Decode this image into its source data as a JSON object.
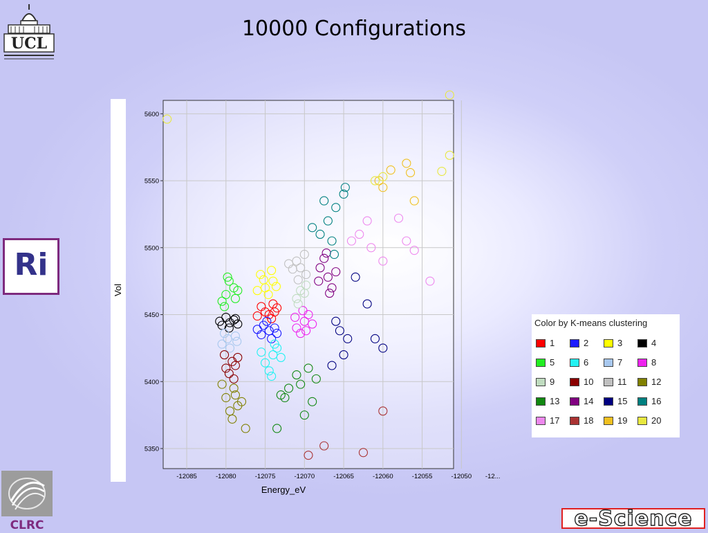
{
  "slide": {
    "title": "10000 Configurations"
  },
  "logos": {
    "ucl": "UCL",
    "ri": "Ri",
    "clrc": "CLRC",
    "escience": "e-Science"
  },
  "chart_data": {
    "type": "scatter",
    "title": "",
    "xlabel": "Energy_eV",
    "ylabel": "Vol",
    "xlim": [
      -12088,
      -12051
    ],
    "ylim": [
      5335,
      5610
    ],
    "x_ticks": [
      -12085,
      -12080,
      -12075,
      -12070,
      -12065,
      -12060,
      -12055,
      -12050
    ],
    "x_tick_labels": [
      "-12085",
      "-12080",
      "-12075",
      "-12070",
      "-12065",
      "-12060",
      "-12055",
      "-12050",
      "-12..."
    ],
    "y_ticks": [
      5350,
      5400,
      5450,
      5500,
      5550,
      5600
    ],
    "y_tick_labels": [
      "5350",
      "5400",
      "5450",
      "5500",
      "5550",
      "5600"
    ],
    "grid": true,
    "marker": "open-circle",
    "legend": {
      "title": "Color by K-means clustering",
      "placement": "right",
      "entries": [
        {
          "label": "1",
          "color": "#ff0000"
        },
        {
          "label": "2",
          "color": "#1a1aff"
        },
        {
          "label": "3",
          "color": "#ffff00"
        },
        {
          "label": "4",
          "color": "#000000"
        },
        {
          "label": "5",
          "color": "#22ee22"
        },
        {
          "label": "6",
          "color": "#22f2f2"
        },
        {
          "label": "7",
          "color": "#a8c8ee"
        },
        {
          "label": "8",
          "color": "#ee22ee"
        },
        {
          "label": "9",
          "color": "#c0dcc0"
        },
        {
          "label": "10",
          "color": "#8b0000"
        },
        {
          "label": "11",
          "color": "#c0c0c0"
        },
        {
          "label": "12",
          "color": "#808000"
        },
        {
          "label": "13",
          "color": "#118811"
        },
        {
          "label": "14",
          "color": "#800080"
        },
        {
          "label": "15",
          "color": "#000080"
        },
        {
          "label": "16",
          "color": "#008080"
        },
        {
          "label": "17",
          "color": "#ee88ee"
        },
        {
          "label": "18",
          "color": "#aa3333"
        },
        {
          "label": "19",
          "color": "#f0c020"
        },
        {
          "label": "20",
          "color": "#e8e840"
        }
      ]
    },
    "series": [
      {
        "cluster": "1",
        "color": "#ff0000",
        "points": [
          [
            -12074.5,
            5450
          ],
          [
            -12075.5,
            5456
          ],
          [
            -12073.8,
            5452
          ],
          [
            -12074.2,
            5447
          ],
          [
            -12075,
            5452
          ],
          [
            -12073.5,
            5455
          ],
          [
            -12076,
            5449
          ],
          [
            -12074,
            5458
          ]
        ]
      },
      {
        "cluster": "2",
        "color": "#1a1aff",
        "points": [
          [
            -12074.5,
            5438
          ],
          [
            -12075.5,
            5435
          ],
          [
            -12073.8,
            5440
          ],
          [
            -12074.2,
            5432
          ],
          [
            -12075.2,
            5442
          ],
          [
            -12073.5,
            5436
          ],
          [
            -12076,
            5439
          ],
          [
            -12074.8,
            5445
          ]
        ]
      },
      {
        "cluster": "3",
        "color": "#ffff00",
        "points": [
          [
            -12075,
            5470
          ],
          [
            -12074,
            5475
          ],
          [
            -12075.6,
            5480
          ],
          [
            -12074.6,
            5465
          ],
          [
            -12073.6,
            5471
          ],
          [
            -12075.2,
            5476
          ],
          [
            -12074.2,
            5483
          ],
          [
            -12076,
            5468
          ]
        ]
      },
      {
        "cluster": "4",
        "color": "#000000",
        "points": [
          [
            -12079.5,
            5444
          ],
          [
            -12080.5,
            5442
          ],
          [
            -12079,
            5446
          ],
          [
            -12080,
            5448
          ],
          [
            -12078.5,
            5443
          ],
          [
            -12080.8,
            5445
          ],
          [
            -12079.6,
            5440
          ],
          [
            -12078.8,
            5447
          ]
        ]
      },
      {
        "cluster": "5",
        "color": "#22ee22",
        "points": [
          [
            -12080,
            5465
          ],
          [
            -12079,
            5470
          ],
          [
            -12080.5,
            5460
          ],
          [
            -12078.8,
            5462
          ],
          [
            -12079.6,
            5475
          ],
          [
            -12080.2,
            5456
          ],
          [
            -12078.5,
            5468
          ],
          [
            -12079.8,
            5478
          ]
        ]
      },
      {
        "cluster": "6",
        "color": "#22f2f2",
        "points": [
          [
            -12074,
            5420
          ],
          [
            -12075,
            5414
          ],
          [
            -12073.5,
            5425
          ],
          [
            -12074.5,
            5408
          ],
          [
            -12073,
            5418
          ],
          [
            -12075.5,
            5422
          ],
          [
            -12074.2,
            5404
          ],
          [
            -12073.8,
            5428
          ]
        ]
      },
      {
        "cluster": "7",
        "color": "#a8c8ee",
        "points": [
          [
            -12079.8,
            5432
          ],
          [
            -12080.5,
            5428
          ],
          [
            -12078.8,
            5434
          ],
          [
            -12079.5,
            5425
          ],
          [
            -12080.2,
            5436
          ],
          [
            -12078.6,
            5430
          ]
        ]
      },
      {
        "cluster": "8",
        "color": "#ee22ee",
        "points": [
          [
            -12070,
            5445
          ],
          [
            -12071,
            5440
          ],
          [
            -12069.5,
            5450
          ],
          [
            -12070.5,
            5436
          ],
          [
            -12069,
            5443
          ],
          [
            -12071.2,
            5448
          ],
          [
            -12070.2,
            5453
          ],
          [
            -12069.8,
            5438
          ]
        ]
      },
      {
        "cluster": "9",
        "color": "#c0dcc0",
        "points": [
          [
            -12070.5,
            5468
          ],
          [
            -12071,
            5462
          ],
          [
            -12069.8,
            5472
          ],
          [
            -12070.8,
            5458
          ],
          [
            -12070,
            5466
          ]
        ]
      },
      {
        "cluster": "10",
        "color": "#8b0000",
        "points": [
          [
            -12079.2,
            5415
          ],
          [
            -12080,
            5410
          ],
          [
            -12078.5,
            5418
          ],
          [
            -12079.6,
            5406
          ],
          [
            -12078.8,
            5412
          ],
          [
            -12080.2,
            5420
          ],
          [
            -12079,
            5402
          ]
        ]
      },
      {
        "cluster": "11",
        "color": "#c0c0c0",
        "points": [
          [
            -12070.5,
            5485
          ],
          [
            -12071,
            5490
          ],
          [
            -12069.8,
            5480
          ],
          [
            -12071.5,
            5484
          ],
          [
            -12070,
            5495
          ],
          [
            -12072,
            5488
          ],
          [
            -12070.8,
            5476
          ]
        ]
      },
      {
        "cluster": "12",
        "color": "#808000",
        "points": [
          [
            -12079,
            5395
          ],
          [
            -12080,
            5388
          ],
          [
            -12078.5,
            5382
          ],
          [
            -12079.5,
            5378
          ],
          [
            -12080.5,
            5398
          ],
          [
            -12078.8,
            5390
          ],
          [
            -12079.2,
            5372
          ],
          [
            -12077.5,
            5365
          ],
          [
            -12078,
            5385
          ]
        ]
      },
      {
        "cluster": "13",
        "color": "#118811",
        "points": [
          [
            -12071,
            5405
          ],
          [
            -12072,
            5395
          ],
          [
            -12069.5,
            5410
          ],
          [
            -12070.5,
            5398
          ],
          [
            -12073,
            5390
          ],
          [
            -12068.5,
            5402
          ],
          [
            -12069,
            5385
          ],
          [
            -12070,
            5375
          ],
          [
            -12073.5,
            5365
          ],
          [
            -12072.5,
            5388
          ]
        ]
      },
      {
        "cluster": "14",
        "color": "#800080",
        "points": [
          [
            -12067,
            5478
          ],
          [
            -12068,
            5485
          ],
          [
            -12066.5,
            5470
          ],
          [
            -12067.5,
            5492
          ],
          [
            -12066,
            5482
          ],
          [
            -12068.2,
            5475
          ],
          [
            -12066.8,
            5466
          ],
          [
            -12067.2,
            5496
          ]
        ]
      },
      {
        "cluster": "15",
        "color": "#000080",
        "points": [
          [
            -12064.5,
            5432
          ],
          [
            -12066,
            5445
          ],
          [
            -12065,
            5420
          ],
          [
            -12062,
            5458
          ],
          [
            -12061,
            5432
          ],
          [
            -12060,
            5425
          ],
          [
            -12065.5,
            5438
          ],
          [
            -12066.5,
            5412
          ],
          [
            -12063.5,
            5478
          ]
        ]
      },
      {
        "cluster": "16",
        "color": "#008080",
        "points": [
          [
            -12066,
            5530
          ],
          [
            -12067,
            5520
          ],
          [
            -12065,
            5540
          ],
          [
            -12068,
            5510
          ],
          [
            -12066.5,
            5505
          ],
          [
            -12069,
            5515
          ],
          [
            -12067.5,
            5535
          ],
          [
            -12064.8,
            5545
          ],
          [
            -12066.2,
            5495
          ]
        ]
      },
      {
        "cluster": "17",
        "color": "#ee88ee",
        "points": [
          [
            -12063,
            5510
          ],
          [
            -12062,
            5520
          ],
          [
            -12064,
            5505
          ],
          [
            -12061.5,
            5500
          ],
          [
            -12058,
            5522
          ],
          [
            -12057,
            5505
          ],
          [
            -12056,
            5498
          ],
          [
            -12054,
            5475
          ],
          [
            -12060,
            5490
          ]
        ]
      },
      {
        "cluster": "18",
        "color": "#aa3333",
        "points": [
          [
            -12069.5,
            5345
          ],
          [
            -12067.5,
            5352
          ],
          [
            -12062.5,
            5347
          ],
          [
            -12060,
            5378
          ]
        ]
      },
      {
        "cluster": "19",
        "color": "#f0c020",
        "points": [
          [
            -12056,
            5535
          ],
          [
            -12057,
            5563
          ],
          [
            -12059,
            5558
          ],
          [
            -12060,
            5545
          ],
          [
            -12056.5,
            5556
          ],
          [
            -12060.5,
            5550
          ]
        ]
      },
      {
        "cluster": "20",
        "color": "#e8e840",
        "points": [
          [
            -12087.5,
            5596
          ],
          [
            -12051.5,
            5614
          ],
          [
            -12051.5,
            5569
          ],
          [
            -12052.5,
            5557
          ],
          [
            -12060,
            5553
          ],
          [
            -12061,
            5550
          ]
        ]
      }
    ]
  }
}
